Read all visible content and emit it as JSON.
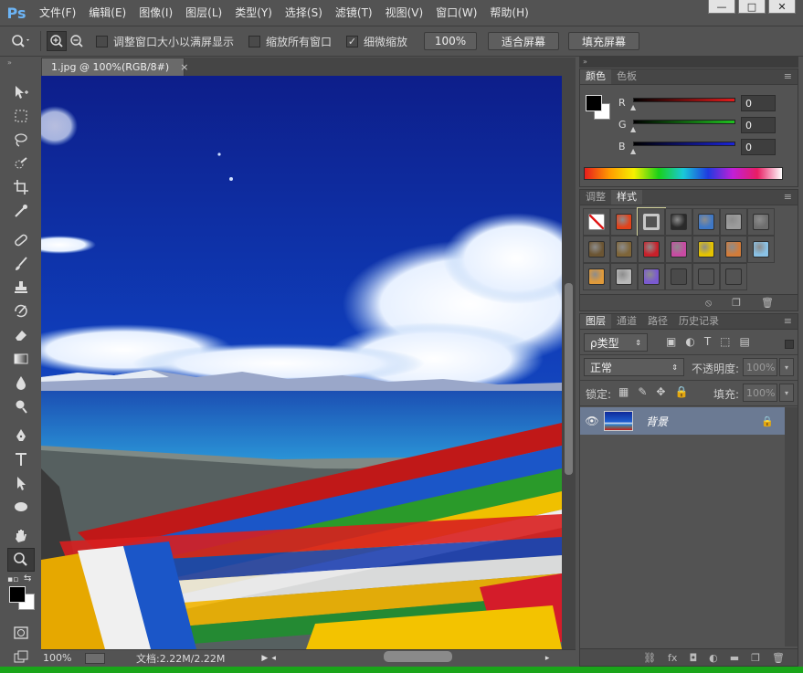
{
  "app": {
    "logo": "Ps"
  },
  "menubar": {
    "items": [
      "文件(F)",
      "编辑(E)",
      "图像(I)",
      "图层(L)",
      "类型(Y)",
      "选择(S)",
      "滤镜(T)",
      "视图(V)",
      "窗口(W)",
      "帮助(H)"
    ]
  },
  "window_controls": {
    "minimize": "—",
    "maximize": "□",
    "close": "✕"
  },
  "options": {
    "resize_windows_label": "调整窗口大小以满屏显示",
    "resize_windows_checked": false,
    "zoom_all_label": "缩放所有窗口",
    "zoom_all_checked": false,
    "scrubby_label": "细微缩放",
    "scrubby_checked": true,
    "zoom_100_label": "100%",
    "fit_screen_label": "适合屏幕",
    "fill_screen_label": "填充屏幕"
  },
  "tools": [
    "move-tool",
    "marquee-tool",
    "lasso-tool",
    "quick-select-tool",
    "crop-tool",
    "eyedropper-tool",
    "healing-brush-tool",
    "brush-tool",
    "clone-stamp-tool",
    "history-brush-tool",
    "eraser-tool",
    "gradient-tool",
    "blur-tool",
    "dodge-tool",
    "pen-tool",
    "type-tool",
    "path-select-tool",
    "ellipse-tool",
    "hand-tool",
    "zoom-tool"
  ],
  "document": {
    "tab_title": "1.jpg @ 100%(RGB/8#)",
    "tab_close": "×"
  },
  "status": {
    "zoom": "100%",
    "doc_info": "文档:2.22M/2.22M"
  },
  "color_panel": {
    "tabs": [
      "颜色",
      "色板"
    ],
    "active_tab": "颜色",
    "channels": [
      {
        "label": "R",
        "value": "0",
        "color": "#e21b1b"
      },
      {
        "label": "G",
        "value": "0",
        "color": "#1fc11f"
      },
      {
        "label": "B",
        "value": "0",
        "color": "#1a23d8"
      }
    ],
    "foreground": "#000000",
    "background": "#ffffff"
  },
  "styles_panel": {
    "tabs": [
      "调整",
      "样式"
    ],
    "active_tab": "样式",
    "swatches": [
      {
        "name": "no-style-swatch",
        "color": "#ffffff"
      },
      {
        "name": "red-glow-swatch",
        "color": "#e2421a"
      },
      {
        "name": "frame-swatch",
        "color": "#8a8a8a"
      },
      {
        "name": "chrome-ball-swatch",
        "color": "#2a2a2a"
      },
      {
        "name": "blue-glass-swatch",
        "color": "#3f78c6"
      },
      {
        "name": "gray-swatch",
        "color": "#9c9c9c"
      },
      {
        "name": "dark-bevel-swatch",
        "color": "#6e6e6e"
      },
      {
        "name": "brown-swatch",
        "color": "#6b5533"
      },
      {
        "name": "brown-texture-swatch",
        "color": "#7e6539"
      },
      {
        "name": "red-button-swatch",
        "color": "#c8202a"
      },
      {
        "name": "multicolor-swatch",
        "color": "#c94aa3"
      },
      {
        "name": "yellow-swatch",
        "color": "#e6c400"
      },
      {
        "name": "orange-gradient-swatch",
        "color": "#d27c3a"
      },
      {
        "name": "sky-swatch",
        "color": "#8ac2e6"
      },
      {
        "name": "sunset-swatch",
        "color": "#e09a3a"
      },
      {
        "name": "mosaic-swatch",
        "color": "#b8b8b8"
      },
      {
        "name": "purple-swatch",
        "color": "#7a5ad0"
      },
      {
        "name": "empty-dark-swatch",
        "color": "#4a4a4a"
      },
      {
        "name": "outline-swatch-1",
        "color": "#535353"
      },
      {
        "name": "outline-swatch-2",
        "color": "#535353"
      }
    ]
  },
  "layers_panel": {
    "tabs": [
      "图层",
      "通道",
      "路径",
      "历史记录"
    ],
    "active_tab": "图层",
    "filter_label": "ρ类型",
    "blend_mode": "正常",
    "opacity_label": "不透明度:",
    "opacity_value": "100%",
    "lock_label": "锁定:",
    "fill_label": "填充:",
    "fill_value": "100%",
    "layers": [
      {
        "name": "背景",
        "visible": true,
        "locked": true
      }
    ]
  }
}
